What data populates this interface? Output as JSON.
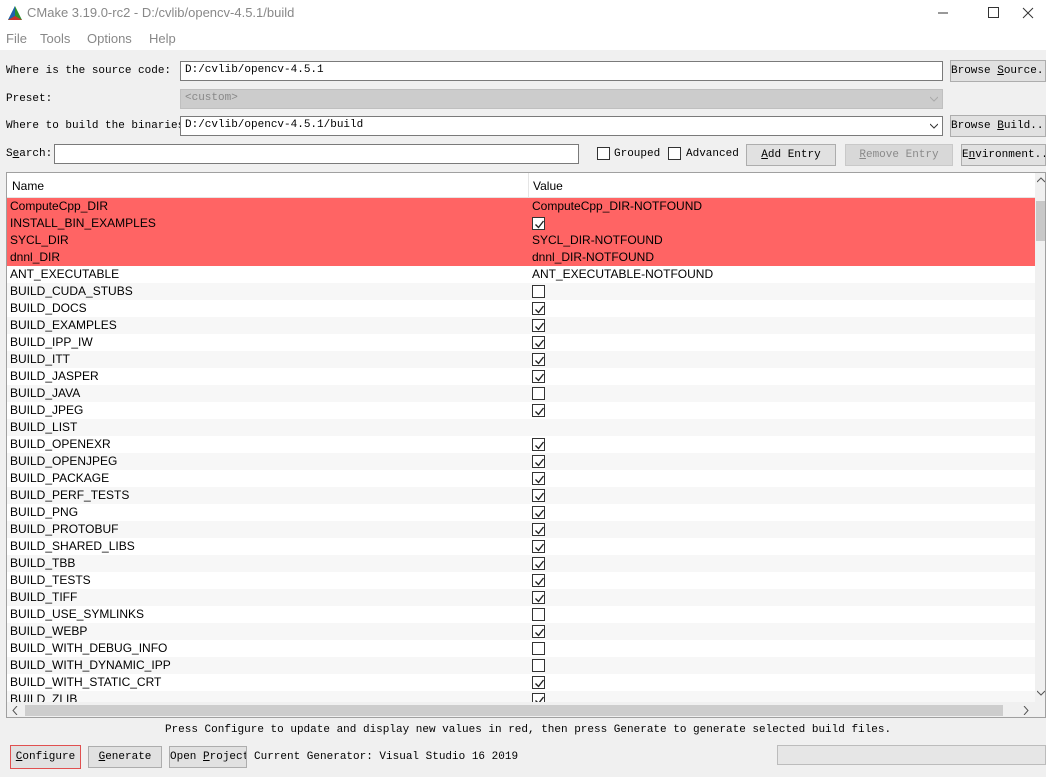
{
  "window": {
    "title": "CMake 3.19.0-rc2 - D:/cvlib/opencv-4.5.1/build",
    "icon": "cmake-triangle-icon"
  },
  "menu": [
    "File",
    "Tools",
    "Options",
    "Help"
  ],
  "source": {
    "label": "Where is the source code:",
    "value": "D:/cvlib/opencv-4.5.1",
    "browse_label": "Browse Source..."
  },
  "preset": {
    "label": "Preset:",
    "value": "<custom>"
  },
  "build": {
    "label": "Where to build the binaries:",
    "value": "D:/cvlib/opencv-4.5.1/build",
    "browse_label": "Browse Build..."
  },
  "search": {
    "label": "Search:",
    "value": "",
    "grouped_label": "Grouped",
    "advanced_label": "Advanced",
    "add_entry_label": "Add Entry",
    "remove_entry_label": "Remove Entry",
    "environment_label": "Environment..."
  },
  "table": {
    "headers": [
      "Name",
      "Value"
    ],
    "rows": [
      {
        "name": "ComputeCpp_DIR",
        "value": "ComputeCpp_DIR-NOTFOUND",
        "new": true
      },
      {
        "name": "INSTALL_BIN_EXAMPLES",
        "check": true,
        "new": true
      },
      {
        "name": "SYCL_DIR",
        "value": "SYCL_DIR-NOTFOUND",
        "new": true
      },
      {
        "name": "dnnl_DIR",
        "value": "dnnl_DIR-NOTFOUND",
        "new": true
      },
      {
        "name": "ANT_EXECUTABLE",
        "value": "ANT_EXECUTABLE-NOTFOUND"
      },
      {
        "name": "BUILD_CUDA_STUBS",
        "check": false
      },
      {
        "name": "BUILD_DOCS",
        "check": true
      },
      {
        "name": "BUILD_EXAMPLES",
        "check": true
      },
      {
        "name": "BUILD_IPP_IW",
        "check": true
      },
      {
        "name": "BUILD_ITT",
        "check": true
      },
      {
        "name": "BUILD_JASPER",
        "check": true
      },
      {
        "name": "BUILD_JAVA",
        "check": false
      },
      {
        "name": "BUILD_JPEG",
        "check": true
      },
      {
        "name": "BUILD_LIST",
        "value": ""
      },
      {
        "name": "BUILD_OPENEXR",
        "check": true
      },
      {
        "name": "BUILD_OPENJPEG",
        "check": true
      },
      {
        "name": "BUILD_PACKAGE",
        "check": true
      },
      {
        "name": "BUILD_PERF_TESTS",
        "check": true
      },
      {
        "name": "BUILD_PNG",
        "check": true
      },
      {
        "name": "BUILD_PROTOBUF",
        "check": true
      },
      {
        "name": "BUILD_SHARED_LIBS",
        "check": true
      },
      {
        "name": "BUILD_TBB",
        "check": true
      },
      {
        "name": "BUILD_TESTS",
        "check": true
      },
      {
        "name": "BUILD_TIFF",
        "check": true
      },
      {
        "name": "BUILD_USE_SYMLINKS",
        "check": false
      },
      {
        "name": "BUILD_WEBP",
        "check": true
      },
      {
        "name": "BUILD_WITH_DEBUG_INFO",
        "check": false
      },
      {
        "name": "BUILD_WITH_DYNAMIC_IPP",
        "check": false
      },
      {
        "name": "BUILD_WITH_STATIC_CRT",
        "check": true
      },
      {
        "name": "BUILD_ZLIB",
        "check": true
      }
    ]
  },
  "status_message": "Press Configure to update and display new values in red, then press Generate to generate selected build files.",
  "buttons": {
    "configure": "Configure",
    "generate": "Generate",
    "open_project": "Open Project"
  },
  "generator_text": "Current Generator: Visual Studio 16 2019",
  "colors": {
    "new_entry_bg": "#ff6464",
    "highlight_border": "#e05050"
  }
}
